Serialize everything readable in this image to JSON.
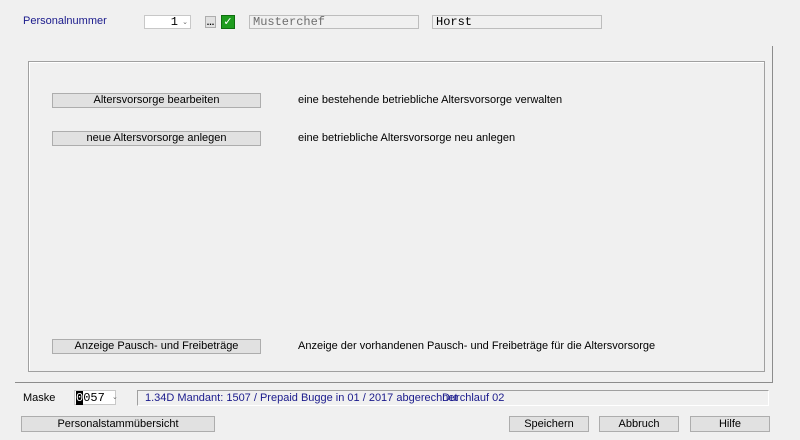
{
  "header": {
    "personalnummer_label": "Personalnummer",
    "personalnummer_value": "1",
    "lookup_button_label": "...",
    "check_icon": "check-icon",
    "nachname": "Musterchef",
    "vorname": "Horst"
  },
  "actions": [
    {
      "button_label": "Altersvorsorge bearbeiten",
      "description": "eine bestehende betriebliche Altersvorsorge verwalten"
    },
    {
      "button_label": "neue Altersvorsorge anlegen",
      "description": "eine betriebliche Altersvorsorge neu anlegen"
    },
    {
      "button_label": "Anzeige Pausch- und Freibeträge",
      "description": "Anzeige der vorhandenen Pausch- und Freibeträge für die Altersvorsorge"
    }
  ],
  "status": {
    "maske_label": "Maske",
    "maske_value_first": "0",
    "maske_value_rest": "057",
    "mandant_text": "1.34D Mandant: 1507 / Prepaid Bugge in 01 / 2017 abgerechnet",
    "durchlauf_text": "Durchlauf 02"
  },
  "footer": {
    "overview_label": "Personalstammübersicht",
    "save_label": "Speichern",
    "cancel_label": "Abbruch",
    "help_label": "Hilfe"
  },
  "colors": {
    "label_blue": "#1a1a8c",
    "check_green": "#1e9c1e",
    "background": "#f0f0f0"
  }
}
